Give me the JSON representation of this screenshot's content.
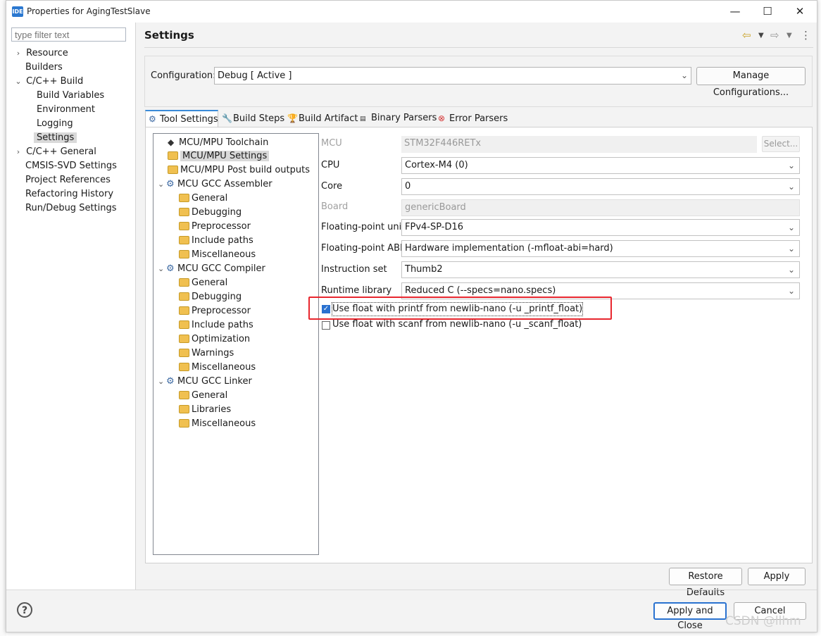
{
  "window": {
    "title": "Properties for AgingTestSlave",
    "app_icon": "IDE"
  },
  "sidebar": {
    "filter_placeholder": "type filter text",
    "items": [
      {
        "label": "Resource"
      },
      {
        "label": "Builders"
      },
      {
        "label": "C/C++ Build"
      },
      {
        "label": "Build Variables"
      },
      {
        "label": "Environment"
      },
      {
        "label": "Logging"
      },
      {
        "label": "Settings"
      },
      {
        "label": "C/C++ General"
      },
      {
        "label": "CMSIS-SVD Settings"
      },
      {
        "label": "Project References"
      },
      {
        "label": "Refactoring History"
      },
      {
        "label": "Run/Debug Settings"
      }
    ]
  },
  "header": {
    "title": "Settings"
  },
  "configuration": {
    "label": "Configuration:",
    "value": "Debug  [ Active ]",
    "manage_button": "Manage Configurations..."
  },
  "tabs": [
    {
      "label": "Tool Settings",
      "icon": "gear-icon"
    },
    {
      "label": "Build Steps",
      "icon": "wrench-icon"
    },
    {
      "label": "Build Artifact",
      "icon": "trophy-icon"
    },
    {
      "label": "Binary Parsers",
      "icon": "binary-icon"
    },
    {
      "label": "Error Parsers",
      "icon": "error-icon"
    }
  ],
  "tree": {
    "items": [
      {
        "label": "MCU/MPU Toolchain"
      },
      {
        "label": "MCU/MPU Settings"
      },
      {
        "label": "MCU/MPU Post build outputs"
      },
      {
        "label": "MCU GCC Assembler"
      },
      {
        "label": "General"
      },
      {
        "label": "Debugging"
      },
      {
        "label": "Preprocessor"
      },
      {
        "label": "Include paths"
      },
      {
        "label": "Miscellaneous"
      },
      {
        "label": "MCU GCC Compiler"
      },
      {
        "label": "General"
      },
      {
        "label": "Debugging"
      },
      {
        "label": "Preprocessor"
      },
      {
        "label": "Include paths"
      },
      {
        "label": "Optimization"
      },
      {
        "label": "Warnings"
      },
      {
        "label": "Miscellaneous"
      },
      {
        "label": "MCU GCC Linker"
      },
      {
        "label": "General"
      },
      {
        "label": "Libraries"
      },
      {
        "label": "Miscellaneous"
      }
    ]
  },
  "form": {
    "mcu": {
      "label": "MCU",
      "value": "STM32F446RETx",
      "button": "Select..."
    },
    "cpu": {
      "label": "CPU",
      "value": "Cortex-M4 (0)"
    },
    "core": {
      "label": "Core",
      "value": "0"
    },
    "board": {
      "label": "Board",
      "value": "genericBoard"
    },
    "fpu": {
      "label": "Floating-point unit",
      "value": "FPv4-SP-D16"
    },
    "fabi": {
      "label": "Floating-point ABI",
      "value": "Hardware implementation (-mfloat-abi=hard)"
    },
    "iset": {
      "label": "Instruction set",
      "value": "Thumb2"
    },
    "runtime": {
      "label": "Runtime library",
      "value": "Reduced C (--specs=nano.specs)"
    },
    "printf_float": {
      "label": "Use float with printf from newlib-nano (-u _printf_float)",
      "checked": true
    },
    "scanf_float": {
      "label": "Use float with scanf from newlib-nano (-u _scanf_float)",
      "checked": false
    }
  },
  "buttons": {
    "restore": "Restore Defaults",
    "apply": "Apply",
    "apply_close": "Apply and Close",
    "cancel": "Cancel"
  },
  "watermark": "CSDN @llhm",
  "colors": {
    "highlight": "#e8262e",
    "accent": "#2a72d0"
  }
}
